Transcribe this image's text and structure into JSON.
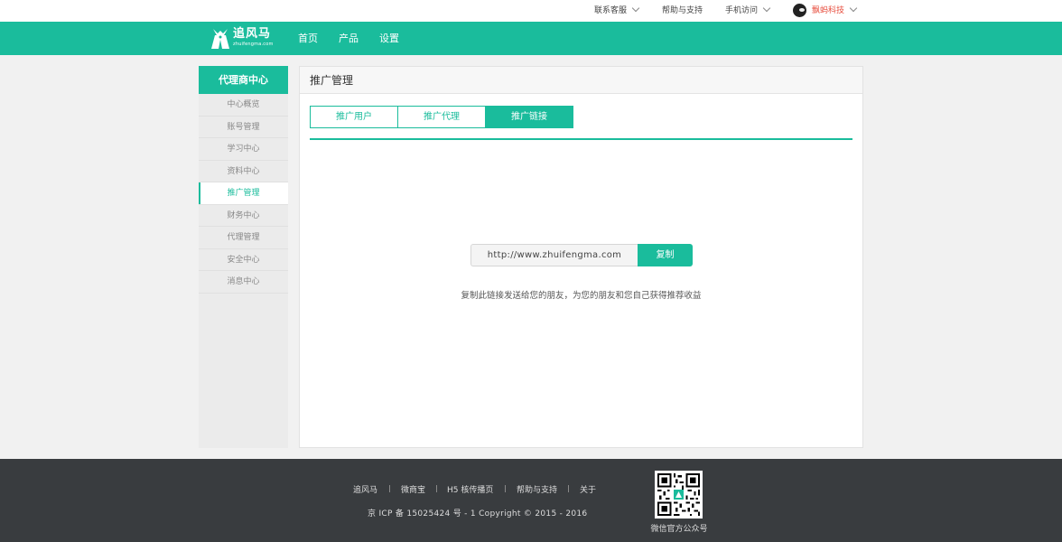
{
  "topbar": {
    "items": [
      {
        "label": "联系客服"
      },
      {
        "label": "帮助与支持"
      },
      {
        "label": "手机访问"
      }
    ],
    "user": {
      "name": "飘蚂科技",
      "color": "#e74c3c"
    }
  },
  "brand": {
    "name": "追风马",
    "domain": "zhuifengma.com",
    "accent": "#1abc9c"
  },
  "nav": {
    "items": [
      {
        "label": "首页"
      },
      {
        "label": "产品"
      },
      {
        "label": "设置"
      }
    ]
  },
  "sidebar": {
    "title": "代理商中心",
    "items": [
      {
        "label": "中心概览"
      },
      {
        "label": "账号管理"
      },
      {
        "label": "学习中心"
      },
      {
        "label": "资料中心"
      },
      {
        "label": "推广管理",
        "active": true
      },
      {
        "label": "财务中心"
      },
      {
        "label": "代理管理"
      },
      {
        "label": "安全中心"
      },
      {
        "label": "消息中心"
      }
    ]
  },
  "main": {
    "title": "推广管理",
    "tabs": [
      {
        "label": "推广用户"
      },
      {
        "label": "推广代理"
      },
      {
        "label": "推广链接",
        "active": true
      }
    ],
    "link": {
      "value": "http://www.zhuifengma.com",
      "copy_label": "复制"
    },
    "hint": "复制此链接发送给您的朋友，为您的朋友和您自己获得推荐收益"
  },
  "footer": {
    "links": [
      {
        "label": "追风马"
      },
      {
        "label": "微商宝"
      },
      {
        "label": "H5 核传播页"
      },
      {
        "label": "帮助与支持"
      },
      {
        "label": "关于"
      }
    ],
    "copyright": "京 ICP 备 15025424 号 - 1   Copyright © 2015 - 2016",
    "qr_caption": "微信官方公众号"
  }
}
